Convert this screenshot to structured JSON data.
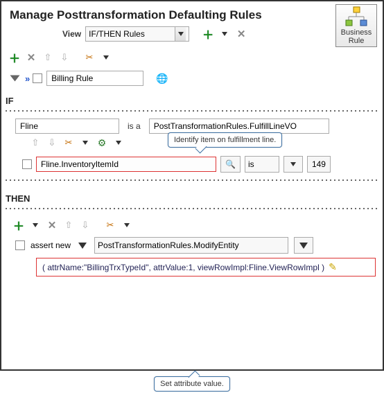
{
  "header": {
    "title": "Manage Posttransformation Defaulting Rules",
    "businessRuleLabel": "Business Rule"
  },
  "view": {
    "label": "View",
    "selected": "IF/THEN Rules"
  },
  "ruleRow": {
    "name": "Billing Rule"
  },
  "sections": {
    "ifLabel": "IF",
    "thenLabel": "THEN"
  },
  "ifClause": {
    "subjectName": "Fline",
    "isA": "is a",
    "typeName": "PostTransformationRules.FulfillLineVO",
    "attribute": "Fline.InventoryItemId",
    "operator": "is",
    "value": "149"
  },
  "callouts": {
    "identify": "Identify item on fulfillment line.",
    "setAttr": "Set attribute value."
  },
  "thenClause": {
    "action": "assert new",
    "entity": "PostTransformationRules.ModifyEntity",
    "attrExpr": "( attrName:\"BillingTrxTypeId\", attrValue:1, viewRowImpl:Fline.ViewRowImpl )"
  }
}
